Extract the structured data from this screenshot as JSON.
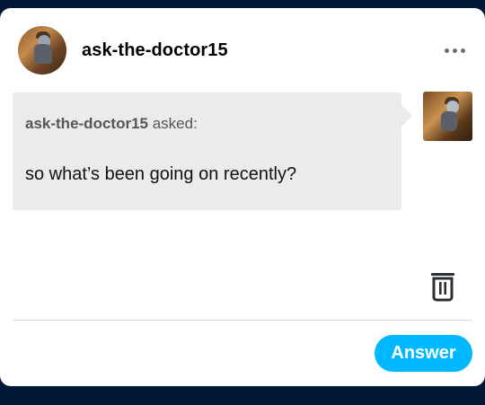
{
  "post": {
    "blog_name": "ask-the-doctor15",
    "more_icon": "more-options-icon",
    "ask": {
      "asker_name": "ask-the-doctor15",
      "asked_label": "asked:",
      "question_text": "so what’s been going on recently?"
    },
    "delete_icon": "trash-icon",
    "answer_label": "Answer"
  },
  "colors": {
    "background": "#001935",
    "card": "#ffffff",
    "bubble": "#ebebeb",
    "accent": "#00b8ff"
  }
}
